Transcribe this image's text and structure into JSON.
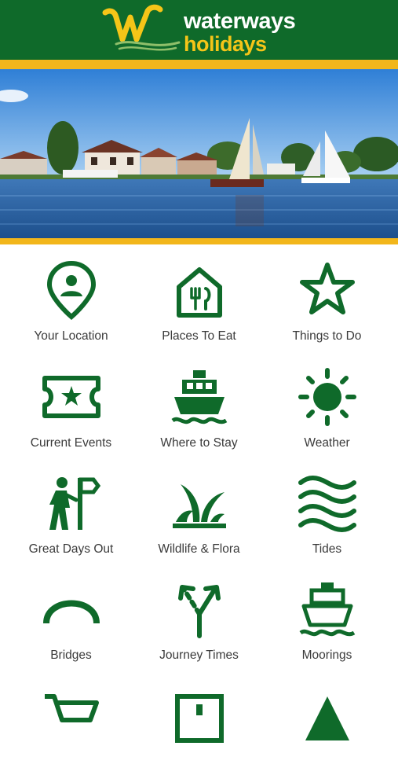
{
  "brand": {
    "line1": "waterways",
    "line2": "holidays"
  },
  "colors": {
    "primary_green": "#0f6a2a",
    "accent_yellow": "#f2b61b",
    "label_text": "#3b3b3b"
  },
  "hero": {
    "subject": "Sailing boats on a river with riverside houses"
  },
  "menu": {
    "items": [
      {
        "label": "Your Location",
        "icon": "location-pin-person-icon"
      },
      {
        "label": "Places To Eat",
        "icon": "restaurant-house-icon"
      },
      {
        "label": "Things to Do",
        "icon": "star-icon"
      },
      {
        "label": "Current Events",
        "icon": "ticket-star-icon"
      },
      {
        "label": "Where to Stay",
        "icon": "boat-icon"
      },
      {
        "label": "Weather",
        "icon": "sun-icon"
      },
      {
        "label": "Great Days Out",
        "icon": "hiker-signpost-icon"
      },
      {
        "label": "Wildlife & Flora",
        "icon": "grass-leaves-icon"
      },
      {
        "label": "Tides",
        "icon": "waves-icon"
      },
      {
        "label": "Bridges",
        "icon": "bridge-arch-icon"
      },
      {
        "label": "Journey Times",
        "icon": "split-arrows-icon"
      },
      {
        "label": "Moorings",
        "icon": "moored-boat-icon"
      }
    ]
  }
}
